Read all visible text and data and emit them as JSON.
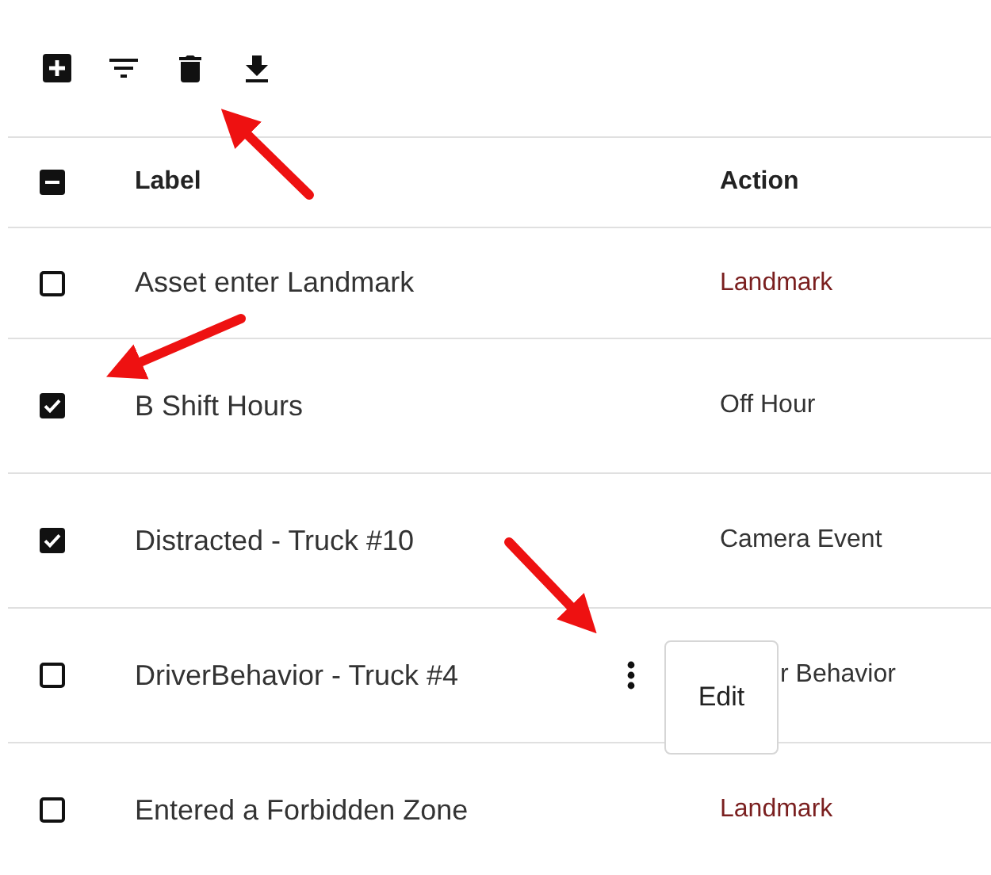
{
  "header": {
    "indeterminate": true,
    "columns": [
      "Label",
      "Action"
    ]
  },
  "rows": [
    {
      "label": "Asset enter Landmark",
      "action": "Landmark",
      "checked": false,
      "color": "#7a1f1f"
    },
    {
      "label": "B Shift Hours",
      "action": "Off Hour",
      "checked": true,
      "color": "#333333"
    },
    {
      "label": "Distracted - Truck #10",
      "action": "Camera Event",
      "checked": true,
      "color": "#333333"
    },
    {
      "label": "DriverBehavior - Truck #4",
      "action": "r Behavior",
      "checked": false,
      "color": "#333333",
      "menu": {
        "items": [
          "Edit"
        ]
      }
    },
    {
      "label": "Entered a Forbidden Zone",
      "action": "Landmark",
      "checked": false,
      "color": "#7a1f1f"
    }
  ]
}
